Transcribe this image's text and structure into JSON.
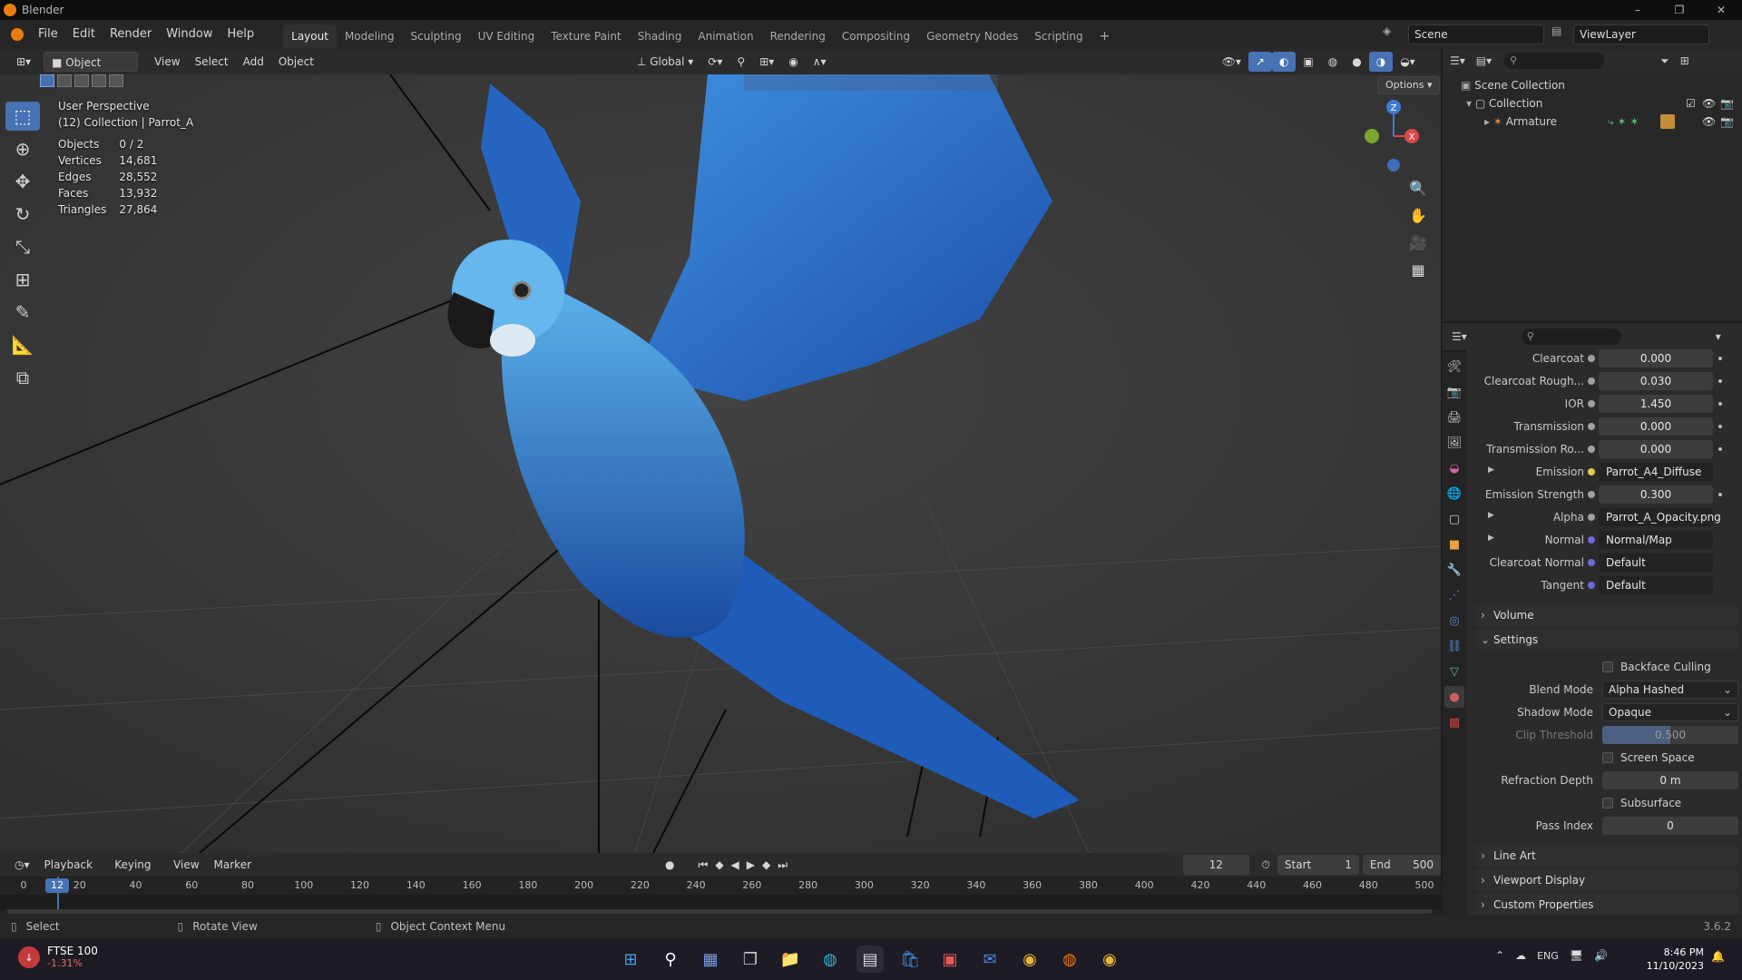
{
  "window": {
    "title": "Blender",
    "controls": [
      "–",
      "❐",
      "✕"
    ]
  },
  "menu": {
    "items": [
      "File",
      "Edit",
      "Render",
      "Window",
      "Help"
    ]
  },
  "workspaces": {
    "tabs": [
      "Layout",
      "Modeling",
      "Sculpting",
      "UV Editing",
      "Texture Paint",
      "Shading",
      "Animation",
      "Rendering",
      "Compositing",
      "Geometry Nodes",
      "Scripting"
    ],
    "active": "Layout",
    "add_label": "+"
  },
  "scene": {
    "label": "Scene",
    "viewlayer": "ViewLayer"
  },
  "viewport_header": {
    "mode": "Object Mode",
    "menus": [
      "View",
      "Select",
      "Add",
      "Object"
    ],
    "orientation": "Global",
    "options_label": "Options"
  },
  "overlay": {
    "perspective": "User Perspective",
    "collection": "(12) Collection | Parrot_A",
    "stats": [
      {
        "label": "Objects",
        "value": "0 / 2"
      },
      {
        "label": "Vertices",
        "value": "14,681"
      },
      {
        "label": "Edges",
        "value": "28,552"
      },
      {
        "label": "Faces",
        "value": "13,932"
      },
      {
        "label": "Triangles",
        "value": "27,864"
      }
    ]
  },
  "gizmo": {
    "z": "Z",
    "x": "X"
  },
  "outliner": {
    "root": "Scene Collection",
    "collection": "Collection",
    "object": "Armature"
  },
  "properties": {
    "rows": [
      {
        "label": "Clearcoat",
        "value": "0.000",
        "dot": "#a0a0a0",
        "type": "num"
      },
      {
        "label": "Clearcoat Rough...",
        "value": "0.030",
        "dot": "#a0a0a0",
        "type": "num"
      },
      {
        "label": "IOR",
        "value": "1.450",
        "dot": "#a0a0a0",
        "type": "num"
      },
      {
        "label": "Transmission",
        "value": "0.000",
        "dot": "#a0a0a0",
        "type": "num"
      },
      {
        "label": "Transmission Ro...",
        "value": "0.000",
        "dot": "#a0a0a0",
        "type": "num"
      },
      {
        "label": "Emission",
        "value": "Parrot_A4_Diffuse",
        "dot": "#e6c84a",
        "type": "txt"
      },
      {
        "label": "Emission Strength",
        "value": "0.300",
        "dot": "#a0a0a0",
        "type": "num"
      },
      {
        "label": "Alpha",
        "value": "Parrot_A_Opacity.png",
        "dot": "#a0a0a0",
        "type": "txt"
      },
      {
        "label": "Normal",
        "value": "Normal/Map",
        "dot": "#6c6cd8",
        "type": "txt"
      },
      {
        "label": "Clearcoat Normal",
        "value": "Default",
        "dot": "#6c6cd8",
        "type": "txt"
      },
      {
        "label": "Tangent",
        "value": "Default",
        "dot": "#6c6cd8",
        "type": "txt"
      }
    ],
    "volume_label": "Volume",
    "settings_label": "Settings",
    "backface_culling": "Backface Culling",
    "blend_mode_label": "Blend Mode",
    "blend_mode": "Alpha Hashed",
    "shadow_mode_label": "Shadow Mode",
    "shadow_mode": "Opaque",
    "clip_threshold_label": "Clip Threshold",
    "clip_threshold": "0.500",
    "ssr_label": "Screen Space Refraction",
    "refraction_depth_label": "Refraction Depth",
    "refraction_depth": "0 m",
    "sss_label": "Subsurface Translucency",
    "pass_index_label": "Pass Index",
    "pass_index": "0",
    "line_art": "Line Art",
    "viewport_display": "Viewport Display",
    "custom_properties": "Custom Properties"
  },
  "timeline": {
    "menus": [
      "Playback",
      "Keying",
      "View",
      "Marker"
    ],
    "current_frame": "12",
    "start_label": "Start",
    "start": "1",
    "end_label": "End",
    "end": "500",
    "ticks": [
      "0",
      "20",
      "40",
      "60",
      "80",
      "100",
      "120",
      "140",
      "160",
      "180",
      "200",
      "220",
      "240",
      "260",
      "280",
      "300",
      "320",
      "340",
      "360",
      "380",
      "400",
      "420",
      "440",
      "460",
      "480",
      "500"
    ],
    "playhead": "12"
  },
  "statusbar": {
    "select": "Select",
    "rotate": "Rotate View",
    "context": "Object Context Menu",
    "version": "3.6.2"
  },
  "taskbar": {
    "stock_name": "FTSE 100",
    "stock_change": "-1.31%",
    "lang": "ENG",
    "time": "8:46 PM",
    "date": "11/10/2023"
  }
}
